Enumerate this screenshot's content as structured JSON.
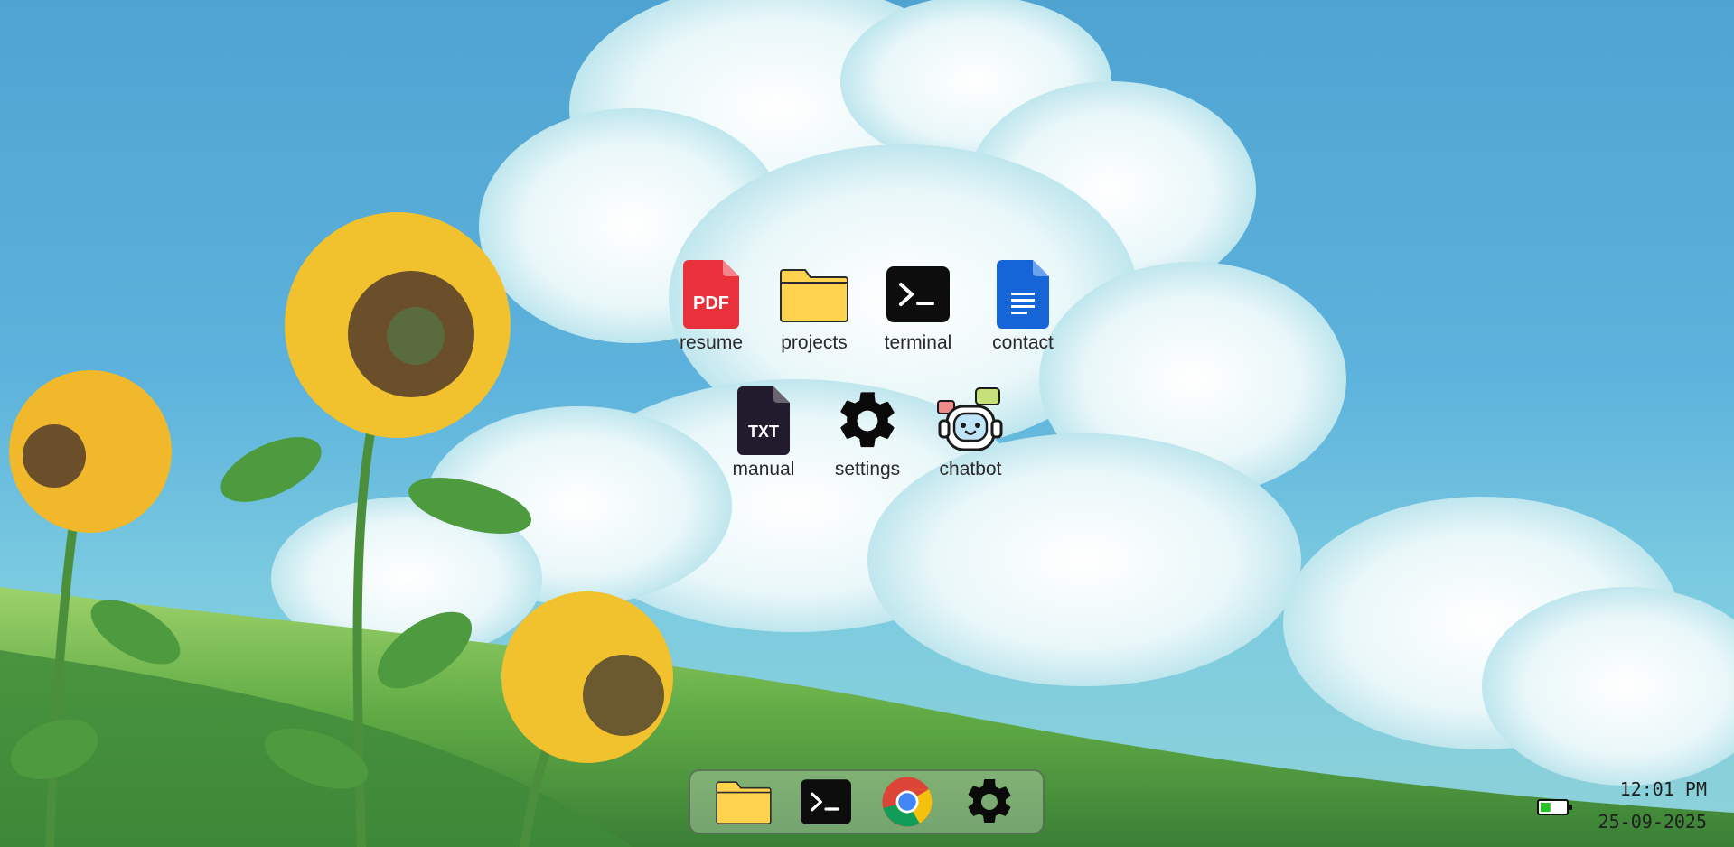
{
  "desktop": {
    "icons": [
      {
        "label": "resume",
        "icon": "pdf-file-icon"
      },
      {
        "label": "projects",
        "icon": "folder-icon"
      },
      {
        "label": "terminal",
        "icon": "terminal-icon"
      },
      {
        "label": "contact",
        "icon": "document-icon"
      },
      {
        "label": "manual",
        "icon": "txt-file-icon"
      },
      {
        "label": "settings",
        "icon": "gear-icon"
      },
      {
        "label": "chatbot",
        "icon": "robot-icon"
      }
    ],
    "pdf_badge": "PDF",
    "txt_badge": "TXT"
  },
  "dock": {
    "items": [
      "folder-icon",
      "terminal-icon",
      "chrome-icon",
      "gear-icon"
    ]
  },
  "tray": {
    "time": "12:01 PM",
    "date": "25-09-2025",
    "battery_level": 0.4
  },
  "colors": {
    "pdf_red": "#e8313a",
    "folder_yellow": "#ffd34e",
    "terminal_black": "#0d0d0d",
    "doc_blue": "#1565d8",
    "txt_dark": "#221b2e",
    "battery_green": "#22c523"
  }
}
